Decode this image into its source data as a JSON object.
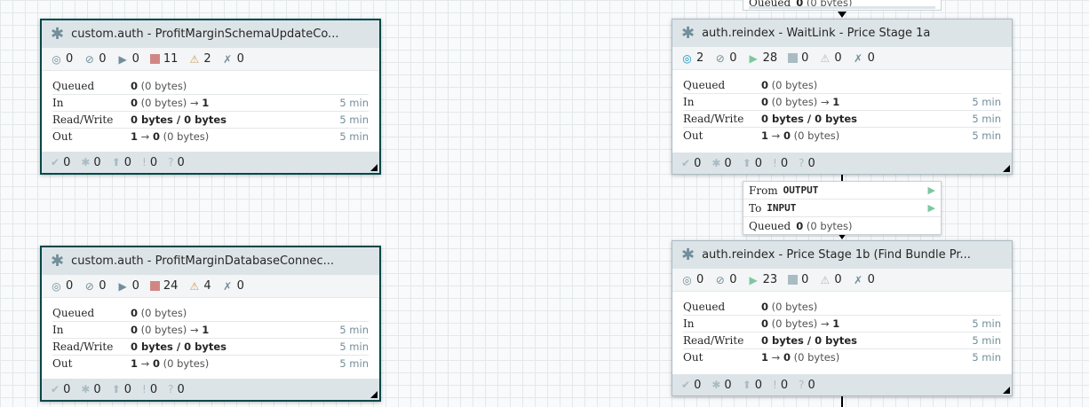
{
  "icons": {
    "group": "✱",
    "transmitting": "◎",
    "not_transmitting": "⊘",
    "running": "▶",
    "stopped": "■",
    "invalid": "⚠",
    "disabled": "✗",
    "up_to_date": "✔",
    "locally_modified": "✱",
    "stale": "⬆",
    "sync_failure": "!",
    "unknown": "?"
  },
  "groups": [
    {
      "name": "custom.auth - ProfitMarginSchemaUpdateCo...",
      "stats": {
        "transmitting": "0",
        "not_transmitting": "0",
        "running": "0",
        "stopped": "11",
        "invalid": "2",
        "disabled": "0"
      },
      "queued": {
        "count": "0",
        "bytes": "(0 bytes)"
      },
      "in": {
        "count": "0",
        "bytes": "(0 bytes)",
        "arrow": "→",
        "ports": "1",
        "time": "5 min"
      },
      "rw": {
        "value": "0 bytes / 0 bytes",
        "time": "5 min"
      },
      "out": {
        "ports": "1",
        "arrow": "→",
        "count": "0",
        "bytes": "(0 bytes)",
        "time": "5 min"
      },
      "footer": {
        "up_to_date": "0",
        "locally_modified": "0",
        "stale": "0",
        "sync_failure": "0",
        "unknown": "0"
      }
    },
    {
      "name": "custom.auth - ProfitMarginDatabaseConnec...",
      "stats": {
        "transmitting": "0",
        "not_transmitting": "0",
        "running": "0",
        "stopped": "24",
        "invalid": "4",
        "disabled": "0"
      },
      "queued": {
        "count": "0",
        "bytes": "(0 bytes)"
      },
      "in": {
        "count": "0",
        "bytes": "(0 bytes)",
        "arrow": "→",
        "ports": "1",
        "time": "5 min"
      },
      "rw": {
        "value": "0 bytes / 0 bytes",
        "time": "5 min"
      },
      "out": {
        "ports": "1",
        "arrow": "→",
        "count": "0",
        "bytes": "(0 bytes)",
        "time": "5 min"
      },
      "footer": {
        "up_to_date": "0",
        "locally_modified": "0",
        "stale": "0",
        "sync_failure": "0",
        "unknown": "0"
      }
    },
    {
      "name": "auth.reindex - WaitLink - Price Stage 1a",
      "stats": {
        "transmitting": "2",
        "not_transmitting": "0",
        "running": "28",
        "stopped": "0",
        "invalid": "0",
        "disabled": "0"
      },
      "queued": {
        "count": "0",
        "bytes": "(0 bytes)"
      },
      "in": {
        "count": "0",
        "bytes": "(0 bytes)",
        "arrow": "→",
        "ports": "1",
        "time": "5 min"
      },
      "rw": {
        "value": "0 bytes / 0 bytes",
        "time": "5 min"
      },
      "out": {
        "ports": "1",
        "arrow": "→",
        "count": "0",
        "bytes": "(0 bytes)",
        "time": "5 min"
      },
      "footer": {
        "up_to_date": "0",
        "locally_modified": "0",
        "stale": "0",
        "sync_failure": "0",
        "unknown": "0"
      }
    },
    {
      "name": "auth.reindex - Price Stage 1b (Find Bundle Pr...",
      "stats": {
        "transmitting": "0",
        "not_transmitting": "0",
        "running": "23",
        "stopped": "0",
        "invalid": "0",
        "disabled": "0"
      },
      "queued": {
        "count": "0",
        "bytes": "(0 bytes)"
      },
      "in": {
        "count": "0",
        "bytes": "(0 bytes)",
        "arrow": "→",
        "ports": "1",
        "time": "5 min"
      },
      "rw": {
        "value": "0 bytes / 0 bytes",
        "time": "5 min"
      },
      "out": {
        "ports": "1",
        "arrow": "→",
        "count": "0",
        "bytes": "(0 bytes)",
        "time": "5 min"
      },
      "footer": {
        "up_to_date": "0",
        "locally_modified": "0",
        "stale": "0",
        "sync_failure": "0",
        "unknown": "0"
      }
    }
  ],
  "labels": {
    "queued": "Queued",
    "in": "In",
    "rw": "Read/Write",
    "out": "Out"
  },
  "connection": {
    "from_label": "From",
    "from_value": "OUTPUT",
    "to_label": "To",
    "to_value": "INPUT",
    "queued_label": "Queued",
    "queued_count": "0",
    "queued_bytes": "(0 bytes)"
  },
  "top_connection": {
    "queued_label": "Queued",
    "queued_count": "0",
    "queued_bytes": "(0 bytes)"
  },
  "colors": {
    "selected_border": "#004849",
    "header_bg": "#dde4e8",
    "running": "#7dc7a0",
    "stopped": "#d18686",
    "invalid": "#cf9f5d",
    "transmitting": "#1491c1"
  }
}
